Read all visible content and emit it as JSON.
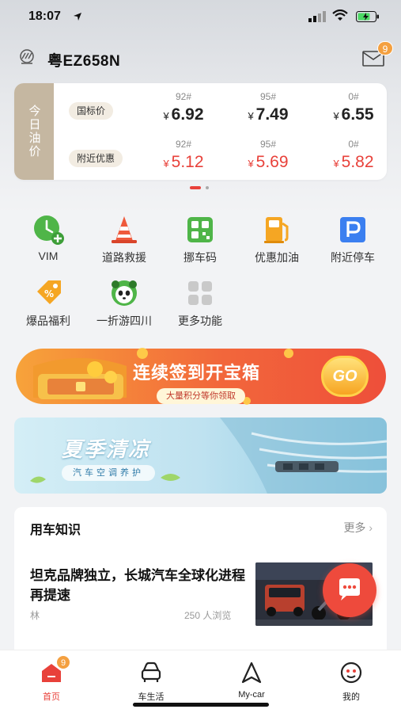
{
  "status_bar": {
    "time": "18:07"
  },
  "header": {
    "plate": "粤EZ658N",
    "mail_badge": "9"
  },
  "oil": {
    "side_label": "今日油价",
    "rows": [
      {
        "label": "国标价",
        "items": [
          {
            "grade": "92#",
            "price": "6.92"
          },
          {
            "grade": "95#",
            "price": "7.49"
          },
          {
            "grade": "0#",
            "price": "6.55"
          }
        ]
      },
      {
        "label": "附近优惠",
        "items": [
          {
            "grade": "92#",
            "price": "5.12"
          },
          {
            "grade": "95#",
            "price": "5.69"
          },
          {
            "grade": "0#",
            "price": "5.82"
          }
        ]
      }
    ],
    "currency": "¥"
  },
  "functions": [
    {
      "label": "VIM",
      "icon": "clock-plus-icon"
    },
    {
      "label": "道路救援",
      "icon": "traffic-cone-icon"
    },
    {
      "label": "挪车码",
      "icon": "qr-code-icon"
    },
    {
      "label": "优惠加油",
      "icon": "fuel-pump-icon"
    },
    {
      "label": "附近停车",
      "icon": "parking-icon"
    },
    {
      "label": "爆品福利",
      "icon": "coupon-tag-icon"
    },
    {
      "label": "一折游四川",
      "icon": "panda-icon"
    },
    {
      "label": "更多功能",
      "icon": "grid-icon"
    }
  ],
  "banner_checkin": {
    "title": "连续签到开宝箱",
    "subtitle": "大量积分等你领取",
    "button": "GO"
  },
  "banner_summer": {
    "title": "夏季清凉",
    "subtitle": "汽车空调养护"
  },
  "knowledge": {
    "title": "用车知识",
    "more": "更多",
    "article": {
      "title": "坦克品牌独立，长城汽车全球化进程再提速",
      "author": "林",
      "views": "250 人浏览"
    }
  },
  "tabbar": [
    {
      "label": "首页",
      "icon": "home-icon",
      "active": true,
      "badge": "9"
    },
    {
      "label": "车生活",
      "icon": "car-icon"
    },
    {
      "label": "My-car",
      "icon": "navigation-arrow-icon"
    },
    {
      "label": "我的",
      "icon": "profile-icon"
    }
  ],
  "colors": {
    "accent": "#e8413a",
    "badge": "#f4a040",
    "oil_side": "#c5b7a1"
  }
}
